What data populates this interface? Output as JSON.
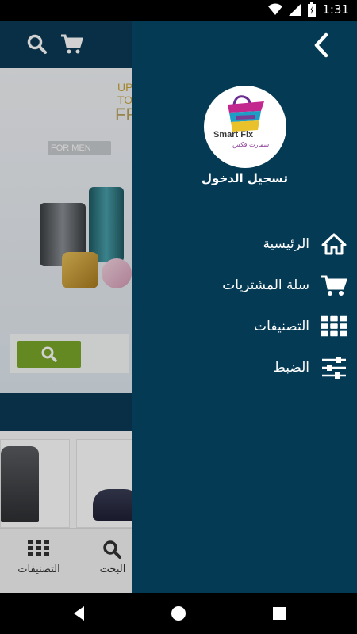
{
  "status_bar": {
    "time": "1:31",
    "icons": [
      "wifi-icon",
      "signal-icon",
      "battery-icon"
    ]
  },
  "background_app": {
    "banner": {
      "promo_line1": "UP T",
      "promo_line2": "TO",
      "promo_big": "FR",
      "for_men_label": "FOR MEN"
    },
    "bottom_nav": {
      "categories_label": "التصنيفات",
      "search_label": "البحث"
    }
  },
  "drawer": {
    "logo": {
      "brand_text": "Smart Fix",
      "brand_sub": "سمارت فكس"
    },
    "login_label": "تسجيل الدخول",
    "menu": [
      {
        "label": "الرئيسية",
        "icon": "home-icon"
      },
      {
        "label": "سلة المشتريات",
        "icon": "cart-icon"
      },
      {
        "label": "التصنيفات",
        "icon": "grid-icon"
      },
      {
        "label": "الضبط",
        "icon": "settings-sliders-icon"
      }
    ]
  },
  "colors": {
    "drawer_bg": "#053a55",
    "accent_green": "#7ba82b",
    "topbar": "#0a3a55"
  }
}
